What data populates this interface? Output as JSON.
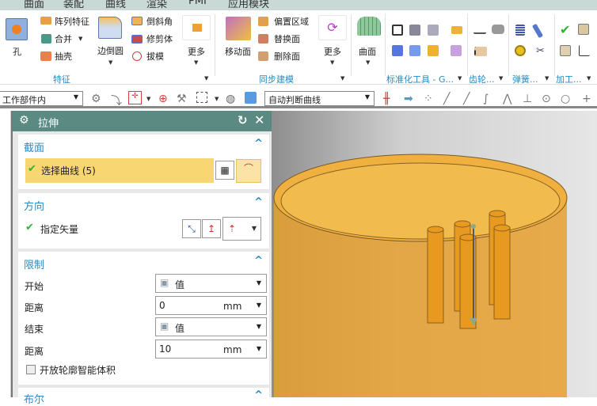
{
  "menu": [
    "曲面",
    "装配",
    "曲线",
    "渲染",
    "PMI",
    "应用模块"
  ],
  "ribbon": {
    "feature": {
      "hole": "孔",
      "pattern": "阵列特征",
      "unite": "合并",
      "shell": "抽壳",
      "edge_blend": "边倒圆",
      "chamfer": "倒斜角",
      "trim_body": "修剪体",
      "draft": "拔模",
      "more": "更多",
      "group": "特征"
    },
    "sync": {
      "move_face": "移动面",
      "offset_region": "偏置区域",
      "replace_face": "替换面",
      "delete_face": "删除面",
      "more": "更多",
      "group": "同步建模"
    },
    "surface": {
      "label": "曲面"
    },
    "groups": {
      "standard": "标准化工具 - G...",
      "gear": "齿轮...",
      "spring": "弹簧...",
      "machining": "加工..."
    }
  },
  "toolbar2": {
    "scope": "工作部件内",
    "curve_rule": "自动判断曲线"
  },
  "dialog": {
    "title": "拉伸",
    "section": {
      "title": "截面",
      "select_curve": "选择曲线 (5)"
    },
    "direction": {
      "title": "方向",
      "specify_vector": "指定矢量"
    },
    "limits": {
      "title": "限制",
      "start_label": "开始",
      "start_value": "值",
      "distance1_label": "距离",
      "distance1": "0",
      "unit1": "mm",
      "end_label": "结束",
      "end_value": "值",
      "distance2_label": "距离",
      "distance2": "10",
      "unit2": "mm",
      "open_profile": "开放轮廓智能体积"
    },
    "boolean": {
      "title": "布尔"
    }
  }
}
